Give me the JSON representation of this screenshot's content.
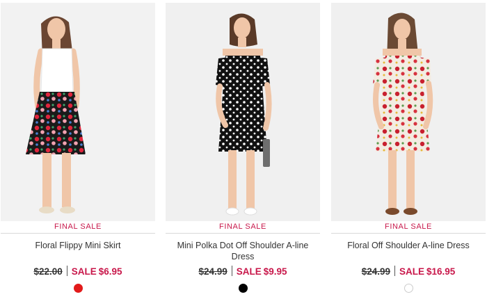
{
  "products": [
    {
      "badge": "FINAL SALE",
      "name": "Floral Flippy Mini Skirt",
      "original_price": "$22.00",
      "sale_label": "SALE",
      "sale_price": "$6.95",
      "swatch_color": "#e21b1b",
      "swatch_border": "#e21b1b"
    },
    {
      "badge": "FINAL SALE",
      "name": "Mini Polka Dot Off Shoulder A-line Dress",
      "original_price": "$24.99",
      "sale_label": "SALE",
      "sale_price": "$9.95",
      "swatch_color": "#000000",
      "swatch_border": "#000000"
    },
    {
      "badge": "FINAL SALE",
      "name": "Floral Off Shoulder A-line Dress",
      "original_price": "$24.99",
      "sale_label": "SALE",
      "sale_price": "$16.95",
      "swatch_color": "#ffffff",
      "swatch_border": "#cccccc"
    }
  ],
  "colors": {
    "accent": "#c8174a",
    "text": "#333333",
    "divider": "#d9d9d9"
  }
}
